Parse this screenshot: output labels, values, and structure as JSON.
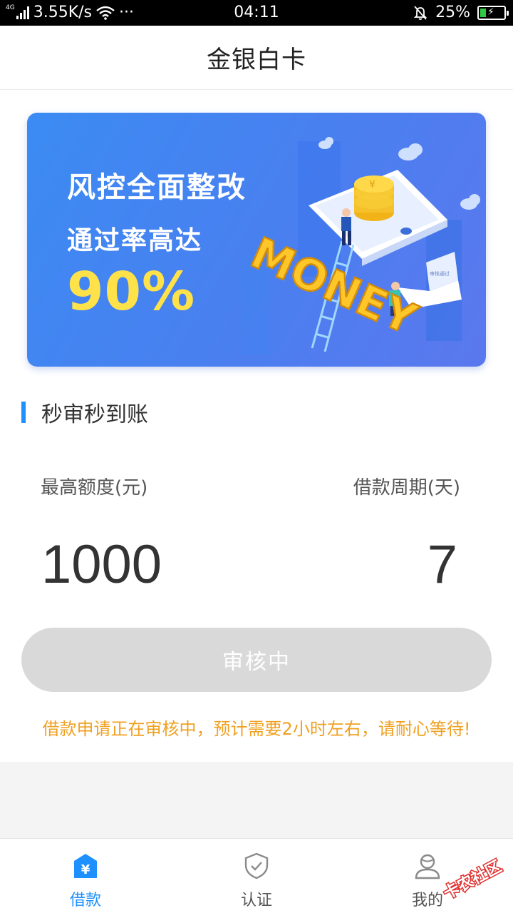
{
  "status_bar": {
    "network_type": "4G",
    "speed": "3.55K/s",
    "more": "···",
    "time": "04:11",
    "battery": "25%",
    "battery_level": 0.25
  },
  "header": {
    "title": "金银白卡"
  },
  "banner": {
    "line1": "风控全面整改",
    "line2": "通过率高达",
    "percent": "90%",
    "illustration_word": "MONEY",
    "screen_caption": "审核通过"
  },
  "section": {
    "title": "秒审秒到账"
  },
  "limits": {
    "max_limit_label": "最高额度(元)",
    "max_limit_value": "1000",
    "period_label": "借款周期(天)",
    "period_value": "7"
  },
  "review_button": {
    "label": "审核中"
  },
  "notice": "借款申请正在审核中，预计需要2小时左右，请耐心等待!",
  "tab_bar": {
    "tabs": [
      {
        "label": "借款",
        "icon": "yuan-house-icon",
        "active": true
      },
      {
        "label": "认证",
        "icon": "shield-check-icon",
        "active": false
      },
      {
        "label": "我的",
        "icon": "user-icon",
        "active": false
      }
    ]
  },
  "watermark": {
    "text": "卡农社区"
  },
  "colors": {
    "accent": "#1e90ff",
    "banner_blue": "#4a7ff0",
    "banner_yellow": "#ffe14a",
    "notice_orange": "#f0a020",
    "button_disabled": "#d9d9d9"
  }
}
